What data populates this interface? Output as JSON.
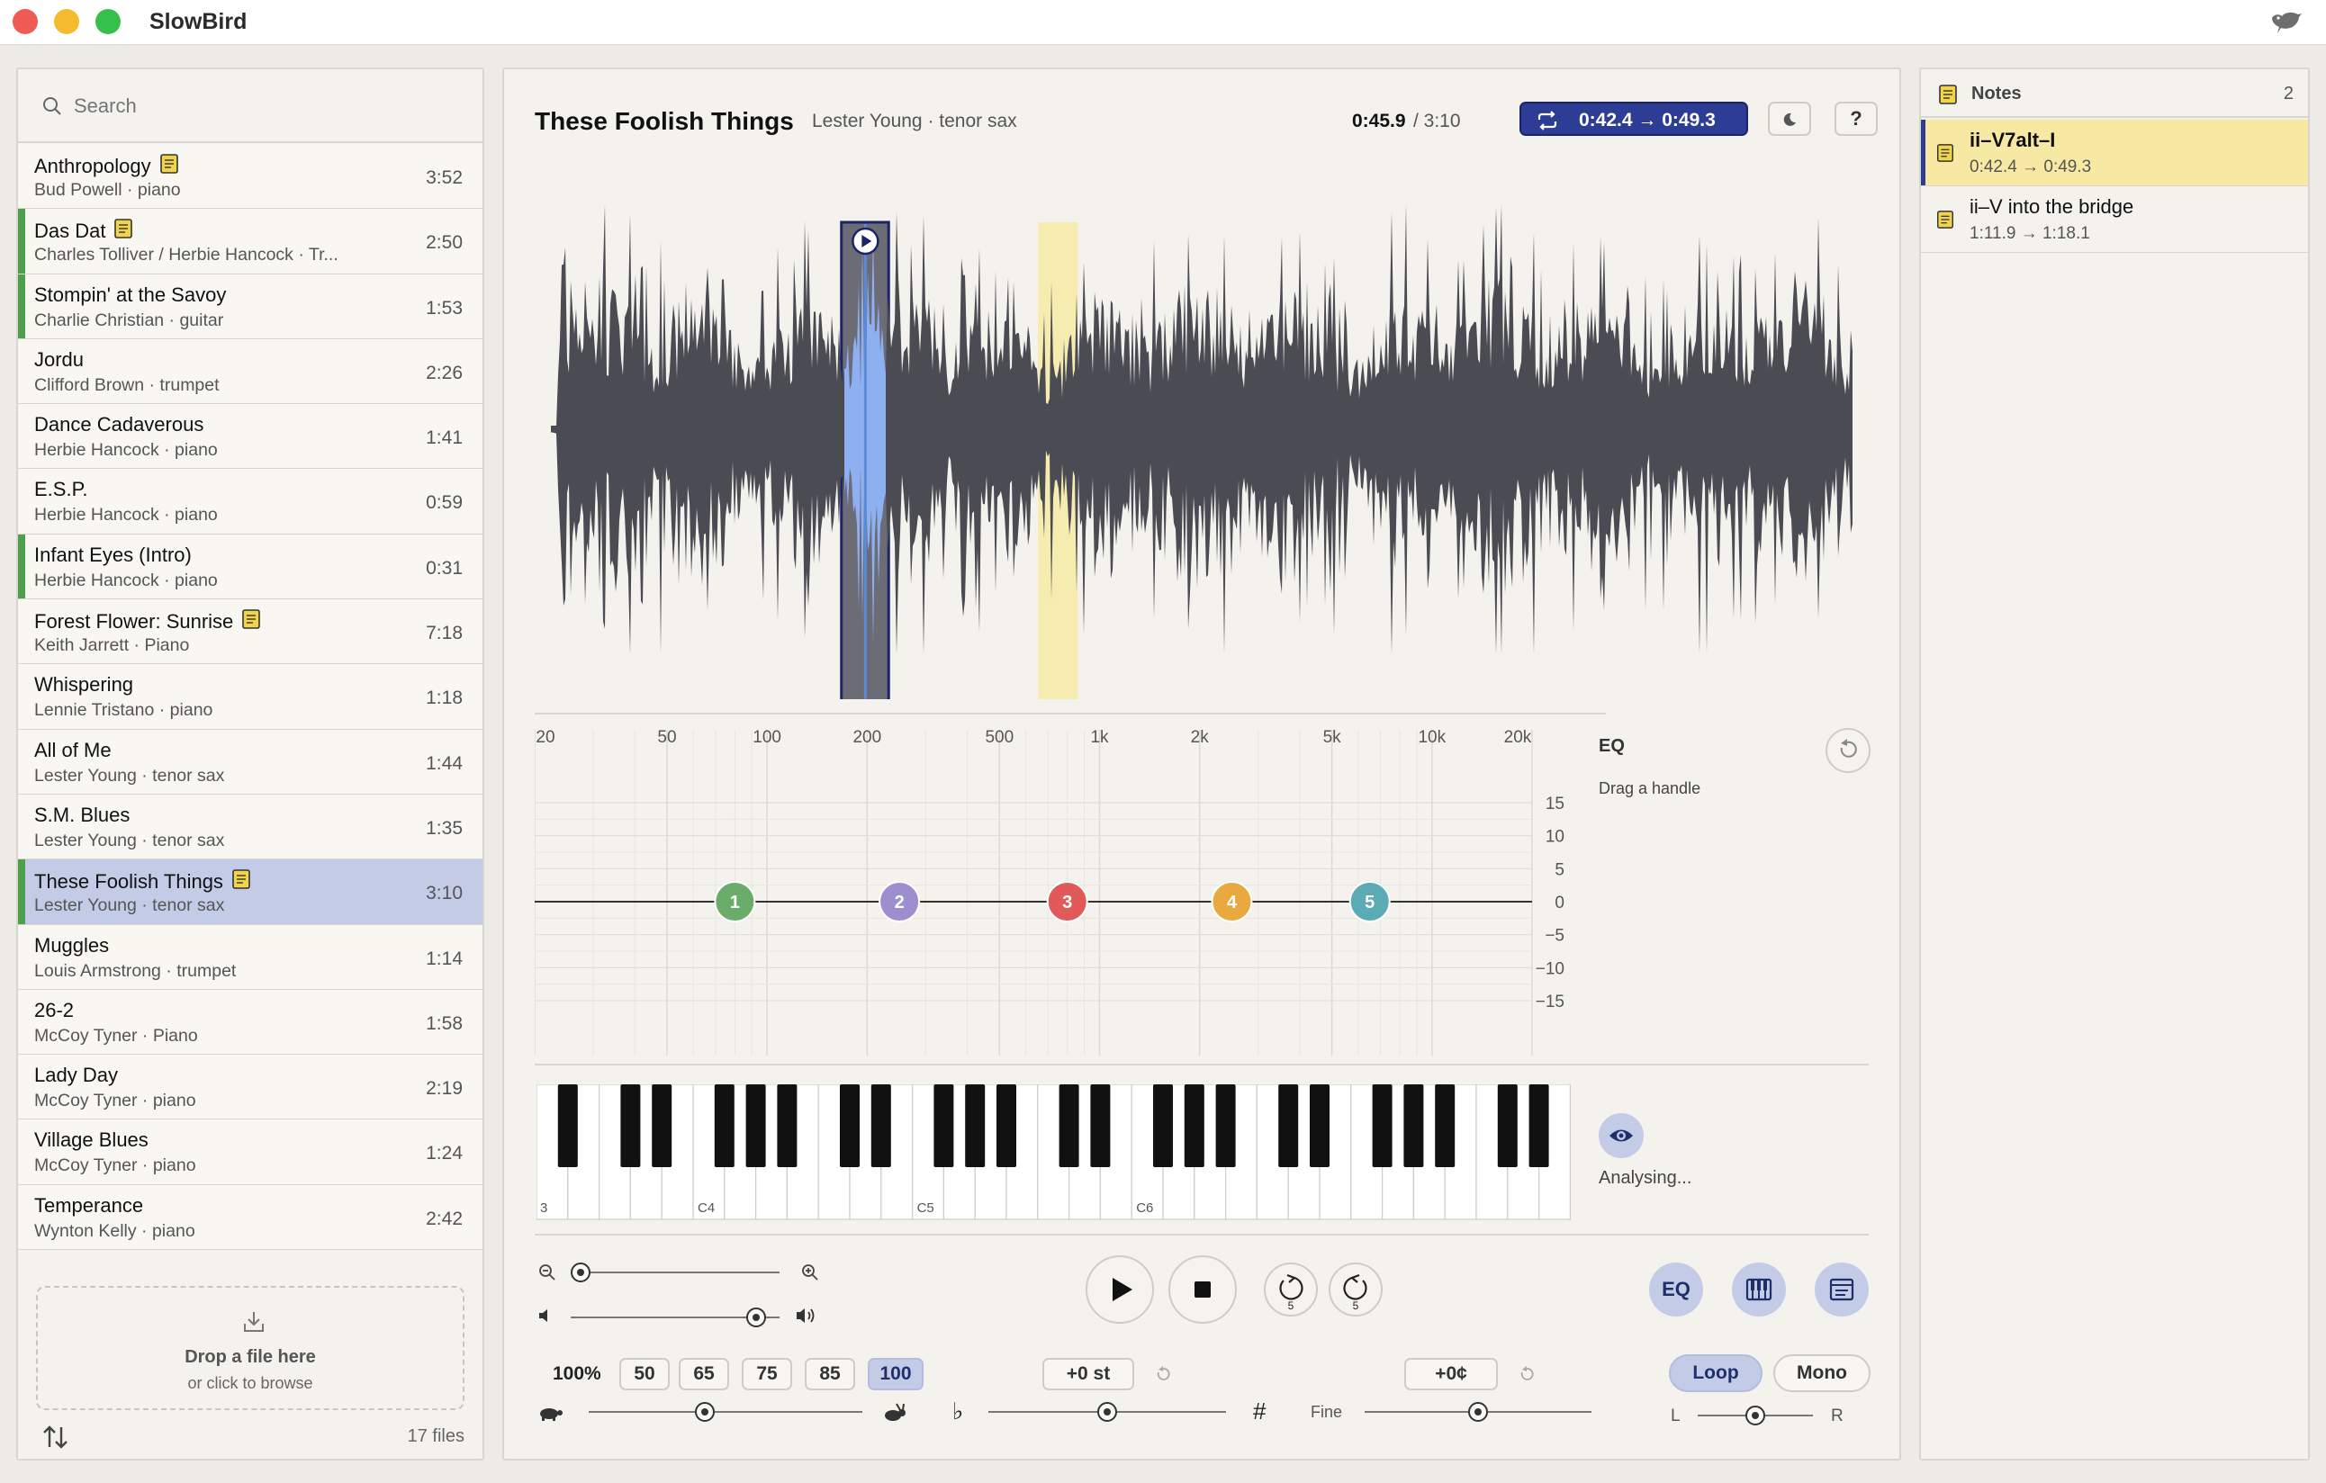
{
  "app": {
    "title": "SlowBird"
  },
  "sidebar": {
    "search_placeholder": "Search",
    "tracks": [
      {
        "title": "Anthropology",
        "subtitle": "Bud Powell · piano",
        "duration": "3:52",
        "has_note": true,
        "marked": false
      },
      {
        "title": "Das Dat",
        "subtitle": "Charles Tolliver / Herbie Hancock · Tr...",
        "duration": "2:50",
        "has_note": true,
        "marked": true
      },
      {
        "title": "Stompin' at the Savoy",
        "subtitle": "Charlie Christian · guitar",
        "duration": "1:53",
        "has_note": false,
        "marked": true
      },
      {
        "title": "Jordu",
        "subtitle": "Clifford Brown · trumpet",
        "duration": "2:26",
        "has_note": false,
        "marked": false
      },
      {
        "title": "Dance Cadaverous",
        "subtitle": "Herbie Hancock · piano",
        "duration": "1:41",
        "has_note": false,
        "marked": false
      },
      {
        "title": "E.S.P.",
        "subtitle": "Herbie Hancock · piano",
        "duration": "0:59",
        "has_note": false,
        "marked": false
      },
      {
        "title": "Infant Eyes (Intro)",
        "subtitle": "Herbie Hancock · piano",
        "duration": "0:31",
        "has_note": false,
        "marked": true
      },
      {
        "title": "Forest Flower: Sunrise",
        "subtitle": "Keith Jarrett · Piano",
        "duration": "7:18",
        "has_note": true,
        "marked": false
      },
      {
        "title": "Whispering",
        "subtitle": "Lennie Tristano · piano",
        "duration": "1:18",
        "has_note": false,
        "marked": false
      },
      {
        "title": "All of Me",
        "subtitle": "Lester Young · tenor sax",
        "duration": "1:44",
        "has_note": false,
        "marked": false
      },
      {
        "title": "S.M. Blues",
        "subtitle": "Lester Young · tenor sax",
        "duration": "1:35",
        "has_note": false,
        "marked": false
      },
      {
        "title": "These Foolish Things",
        "subtitle": "Lester Young · tenor sax",
        "duration": "3:10",
        "has_note": true,
        "marked": true,
        "selected": true
      },
      {
        "title": "Muggles",
        "subtitle": "Louis Armstrong · trumpet",
        "duration": "1:14",
        "has_note": false,
        "marked": false
      },
      {
        "title": "26-2",
        "subtitle": "McCoy Tyner · Piano",
        "duration": "1:58",
        "has_note": false,
        "marked": false
      },
      {
        "title": "Lady Day",
        "subtitle": "McCoy Tyner · piano",
        "duration": "2:19",
        "has_note": false,
        "marked": false
      },
      {
        "title": "Village Blues",
        "subtitle": "McCoy Tyner · piano",
        "duration": "1:24",
        "has_note": false,
        "marked": false
      },
      {
        "title": "Temperance",
        "subtitle": "Wynton Kelly · piano",
        "duration": "2:42",
        "has_note": false,
        "marked": false
      }
    ],
    "drop_title": "Drop a file here",
    "drop_sub": "or click to browse",
    "file_count": "17 files"
  },
  "player": {
    "title": "These Foolish Things",
    "subtitle": "Lester Young · tenor sax",
    "time_current": "0:45.9",
    "time_total": "/ 3:10",
    "loop_range": "0:42.4 → 0:49.3",
    "night_icon": "moon-icon",
    "help_label": "?",
    "loop_start_fraction": 0.2232,
    "loop_end_fraction": 0.2595,
    "playhead_fraction": 0.2416,
    "note_marker_fraction": 0.3784
  },
  "eq": {
    "title": "EQ",
    "hint": "Drag a handle",
    "freq_labels": [
      "20",
      "50",
      "100",
      "200",
      "500",
      "1k",
      "2k",
      "5k",
      "10k",
      "20k"
    ],
    "gain_labels": [
      "15",
      "10",
      "5",
      "0",
      "−5",
      "−10",
      "−15"
    ],
    "bands": [
      {
        "label": "1",
        "freq_hz": 80,
        "gain_db": 0,
        "color": "#6aad6b"
      },
      {
        "label": "2",
        "freq_hz": 250,
        "gain_db": 0,
        "color": "#9b8fd0"
      },
      {
        "label": "3",
        "freq_hz": 800,
        "gain_db": 0,
        "color": "#e05a5a"
      },
      {
        "label": "4",
        "freq_hz": 2500,
        "gain_db": 0,
        "color": "#eaa93e"
      },
      {
        "label": "5",
        "freq_hz": 6500,
        "gain_db": 0,
        "color": "#5aabb5"
      }
    ]
  },
  "keyboard": {
    "octave_labels": [
      "3",
      "C4",
      "C5",
      "C6"
    ],
    "status": "Analysing..."
  },
  "transport": {
    "zoom_fraction": 0.0,
    "volume_fraction": 0.93,
    "back_label": "5",
    "fwd_label": "5",
    "eq_label": "EQ"
  },
  "speed": {
    "current": "100%",
    "presets": [
      "50",
      "65",
      "75",
      "85",
      "100"
    ],
    "active": "100",
    "value_fraction": 0.42
  },
  "pitch": {
    "semitone_label": "+0 st",
    "flat": "♭",
    "sharp": "#",
    "value_fraction": 0.5
  },
  "fine": {
    "label": "Fine",
    "value_label": "+0¢",
    "value_fraction": 0.5
  },
  "output": {
    "loop_label": "Loop",
    "mono_label": "Mono",
    "left": "L",
    "right": "R",
    "balance_fraction": 0.5
  },
  "notes": {
    "title": "Notes",
    "count": "2",
    "items": [
      {
        "title": "ii–V7alt–I",
        "range": "0:42.4 → 0:49.3",
        "selected": true
      },
      {
        "title": "ii–V into the bridge",
        "range": "1:11.9 → 1:18.1",
        "selected": false
      }
    ]
  },
  "colors": {
    "accent": "#2d3d95",
    "selection": "#c3cbe7",
    "marked": "#4f9e4d",
    "waveform": "#4a4b53",
    "loop_region": "#8fb0f0",
    "note_region": "#f6ecb0"
  }
}
